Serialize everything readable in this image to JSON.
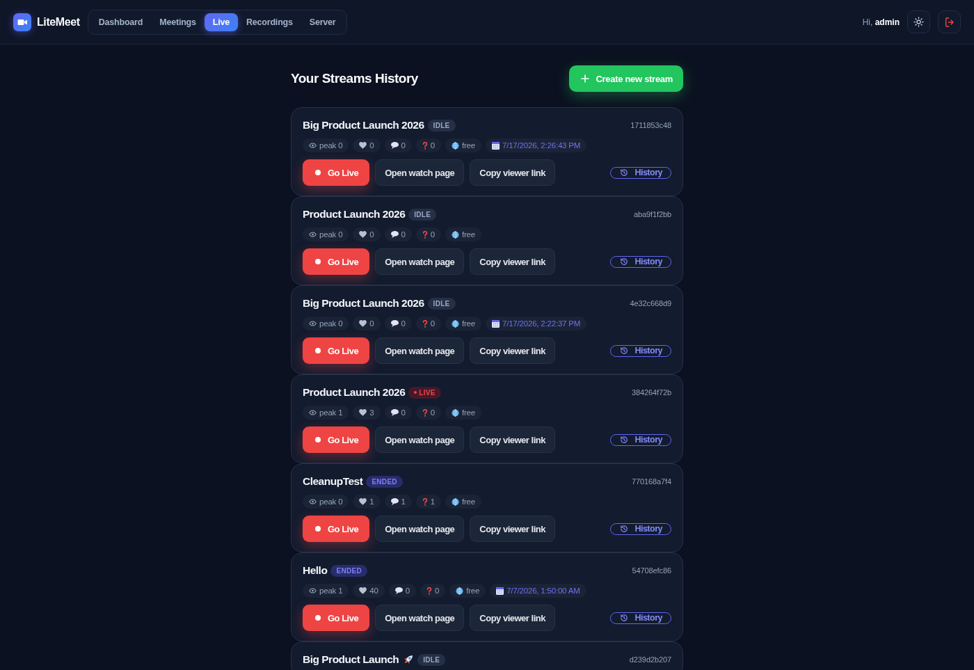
{
  "header": {
    "brand": "LiteMeet",
    "tabs": [
      {
        "label": "Dashboard",
        "selected": false
      },
      {
        "label": "Meetings",
        "selected": false
      },
      {
        "label": "Live",
        "selected": true
      },
      {
        "label": "Recordings",
        "selected": false
      },
      {
        "label": "Server",
        "selected": false
      }
    ],
    "greeting": "Hi, **admin**"
  },
  "page": {
    "title": "Your Streams History",
    "create_button": "Create new stream"
  },
  "streams": [
    {
      "title": "Big Product Launch 2026",
      "title_icon": false,
      "status": {
        "kind": "idle",
        "label": "IDLE"
      },
      "id": "1711853c48",
      "stats": [
        {
          "kind": "peak",
          "value": "peak 0"
        },
        {
          "kind": "likes",
          "value": "0"
        },
        {
          "kind": "comments",
          "value": "0"
        },
        {
          "kind": "questions",
          "value": "0"
        },
        {
          "kind": "access",
          "value": "free"
        },
        {
          "kind": "date",
          "value": "7/17/2026, 2:26:43 PM"
        }
      ],
      "actions": [
        {
          "kind": "go_live",
          "label": "Go Live"
        },
        {
          "kind": "watch_page",
          "label": "Open watch page"
        },
        {
          "kind": "copy_link",
          "label": "Copy viewer link"
        },
        {
          "kind": "history",
          "label": "History"
        }
      ]
    },
    {
      "title": "Product Launch 2026",
      "title_icon": false,
      "status": {
        "kind": "idle",
        "label": "IDLE"
      },
      "id": "aba9f1f2bb",
      "stats": [
        {
          "kind": "peak",
          "value": "peak 0"
        },
        {
          "kind": "likes",
          "value": "0"
        },
        {
          "kind": "comments",
          "value": "0"
        },
        {
          "kind": "questions",
          "value": "0"
        },
        {
          "kind": "access",
          "value": "free"
        }
      ],
      "actions": [
        {
          "kind": "go_live",
          "label": "Go Live"
        },
        {
          "kind": "watch_page",
          "label": "Open watch page"
        },
        {
          "kind": "copy_link",
          "label": "Copy viewer link"
        },
        {
          "kind": "history",
          "label": "History"
        }
      ]
    },
    {
      "title": "Big Product Launch 2026",
      "title_icon": false,
      "status": {
        "kind": "idle",
        "label": "IDLE"
      },
      "id": "4e32c668d9",
      "stats": [
        {
          "kind": "peak",
          "value": "peak 0"
        },
        {
          "kind": "likes",
          "value": "0"
        },
        {
          "kind": "comments",
          "value": "0"
        },
        {
          "kind": "questions",
          "value": "0"
        },
        {
          "kind": "access",
          "value": "free"
        },
        {
          "kind": "date",
          "value": "7/17/2026, 2:22:37 PM"
        }
      ],
      "actions": [
        {
          "kind": "go_live",
          "label": "Go Live"
        },
        {
          "kind": "watch_page",
          "label": "Open watch page"
        },
        {
          "kind": "copy_link",
          "label": "Copy viewer link"
        },
        {
          "kind": "history",
          "label": "History"
        }
      ]
    },
    {
      "title": "Product Launch 2026",
      "title_icon": false,
      "status": {
        "kind": "live",
        "label": "LIVE"
      },
      "id": "384264f72b",
      "stats": [
        {
          "kind": "peak",
          "value": "peak 1"
        },
        {
          "kind": "likes",
          "value": "3"
        },
        {
          "kind": "comments",
          "value": "0"
        },
        {
          "kind": "questions",
          "value": "0"
        },
        {
          "kind": "access",
          "value": "free"
        }
      ],
      "actions": [
        {
          "kind": "go_live",
          "label": "Go Live"
        },
        {
          "kind": "watch_page",
          "label": "Open watch page"
        },
        {
          "kind": "copy_link",
          "label": "Copy viewer link"
        },
        {
          "kind": "history",
          "label": "History"
        }
      ]
    },
    {
      "title": "CleanupTest",
      "title_icon": false,
      "status": {
        "kind": "ended",
        "label": "ENDED"
      },
      "id": "770168a7f4",
      "stats": [
        {
          "kind": "peak",
          "value": "peak 0"
        },
        {
          "kind": "likes",
          "value": "1"
        },
        {
          "kind": "comments",
          "value": "1"
        },
        {
          "kind": "questions",
          "value": "1"
        },
        {
          "kind": "access",
          "value": "free"
        }
      ],
      "actions": [
        {
          "kind": "go_live",
          "label": "Go Live"
        },
        {
          "kind": "watch_page",
          "label": "Open watch page"
        },
        {
          "kind": "copy_link",
          "label": "Copy viewer link"
        },
        {
          "kind": "history",
          "label": "History"
        }
      ]
    },
    {
      "title": "Hello",
      "title_icon": false,
      "status": {
        "kind": "ended",
        "label": "ENDED"
      },
      "id": "54708efc86",
      "stats": [
        {
          "kind": "peak",
          "value": "peak 1"
        },
        {
          "kind": "likes",
          "value": "40"
        },
        {
          "kind": "comments",
          "value": "0"
        },
        {
          "kind": "questions",
          "value": "0"
        },
        {
          "kind": "access",
          "value": "free"
        },
        {
          "kind": "date",
          "value": "7/7/2026, 1:50:00 AM"
        }
      ],
      "actions": [
        {
          "kind": "go_live",
          "label": "Go Live"
        },
        {
          "kind": "watch_page",
          "label": "Open watch page"
        },
        {
          "kind": "copy_link",
          "label": "Copy viewer link"
        },
        {
          "kind": "history",
          "label": "History"
        }
      ]
    },
    {
      "title": "Big Product Launch",
      "title_icon": true,
      "status": {
        "kind": "idle",
        "label": "IDLE"
      },
      "id": "d239d2b207"
    }
  ]
}
